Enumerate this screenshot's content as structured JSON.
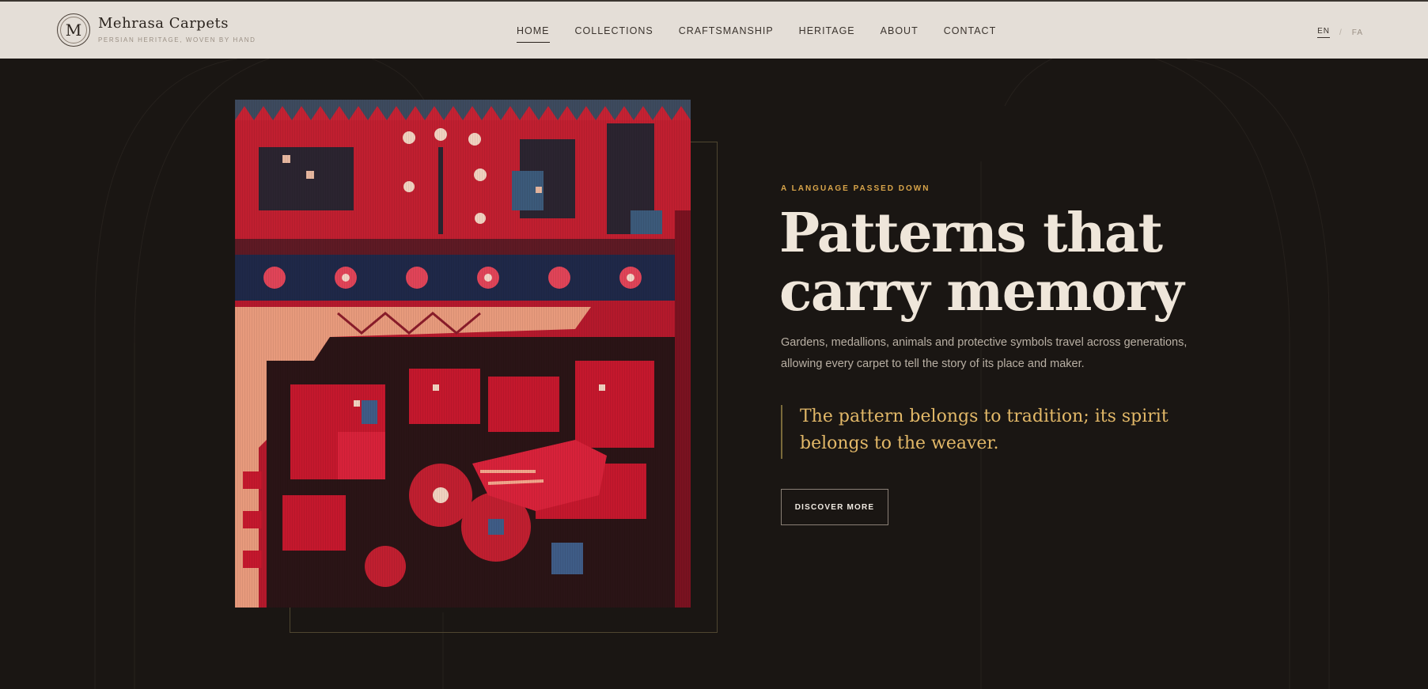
{
  "brand": {
    "logo_letter": "M",
    "name": "Mehrasa Carpets",
    "tagline": "PERSIAN HERITAGE, WOVEN BY HAND"
  },
  "nav": {
    "items": [
      {
        "label": "HOME",
        "active": true
      },
      {
        "label": "COLLECTIONS",
        "active": false
      },
      {
        "label": "CRAFTSMANSHIP",
        "active": false
      },
      {
        "label": "HERITAGE",
        "active": false
      },
      {
        "label": "ABOUT",
        "active": false
      },
      {
        "label": "CONTACT",
        "active": false
      }
    ]
  },
  "language": {
    "current": "EN",
    "separator": "/",
    "alternate": "FA"
  },
  "hero": {
    "eyebrow": "A LANGUAGE PASSED DOWN",
    "headline_line1": "Patterns that",
    "headline_line2": "carry memory",
    "body": "Gardens, medallions, animals and protective symbols travel across generations, allowing every carpet to tell the story of its place and maker.",
    "quote": "The pattern belongs to tradition; its spirit belongs to the weaver.",
    "cta_label": "DISCOVER MORE"
  },
  "colors": {
    "background": "#1a1613",
    "header_bg": "#e4ded7",
    "accent_gold": "#d9a54a",
    "carpet_red": "#b01a2c"
  }
}
